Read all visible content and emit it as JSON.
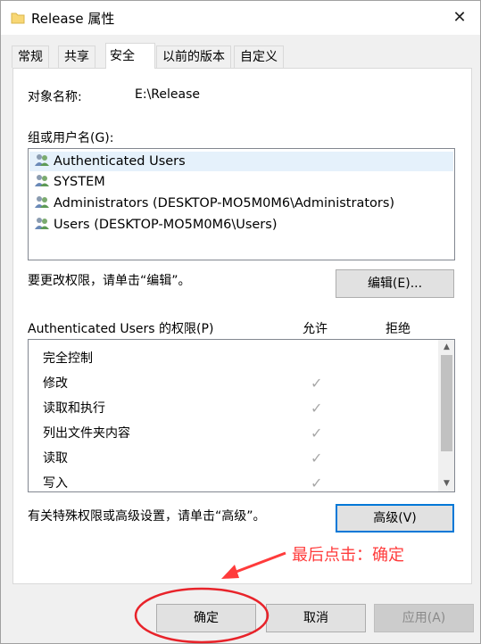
{
  "window": {
    "title": "Release 属性"
  },
  "tabs": [
    {
      "label": "常规"
    },
    {
      "label": "共享"
    },
    {
      "label": "安全"
    },
    {
      "label": "以前的版本"
    },
    {
      "label": "自定义"
    }
  ],
  "object": {
    "label": "对象名称:",
    "value": "E:\\Release"
  },
  "groups": {
    "label": "组或用户名(G):",
    "items": [
      {
        "name": "Authenticated Users"
      },
      {
        "name": "SYSTEM"
      },
      {
        "name": "Administrators (DESKTOP-MO5M0M6\\Administrators)"
      },
      {
        "name": "Users (DESKTOP-MO5M0M6\\Users)"
      }
    ]
  },
  "edit_hint": "要更改权限，请单击“编辑”。",
  "edit_button": "编辑(E)...",
  "permissions": {
    "title": "Authenticated Users 的权限(P)",
    "allow_header": "允许",
    "deny_header": "拒绝",
    "rows": [
      {
        "name": "完全控制",
        "allow": ""
      },
      {
        "name": "修改",
        "allow": "✓"
      },
      {
        "name": "读取和执行",
        "allow": "✓"
      },
      {
        "name": "列出文件夹内容",
        "allow": "✓"
      },
      {
        "name": "读取",
        "allow": "✓"
      },
      {
        "name": "写入",
        "allow": "✓"
      }
    ]
  },
  "advanced_hint": "有关特殊权限或高级设置，请单击“高级”。",
  "advanced_button": "高级(V)",
  "footer": {
    "ok": "确定",
    "cancel": "取消",
    "apply": "应用(A)"
  },
  "annotation": "最后点击：确定",
  "colors": {
    "annotation": "#ff3b3b",
    "focus": "#0078d7"
  }
}
